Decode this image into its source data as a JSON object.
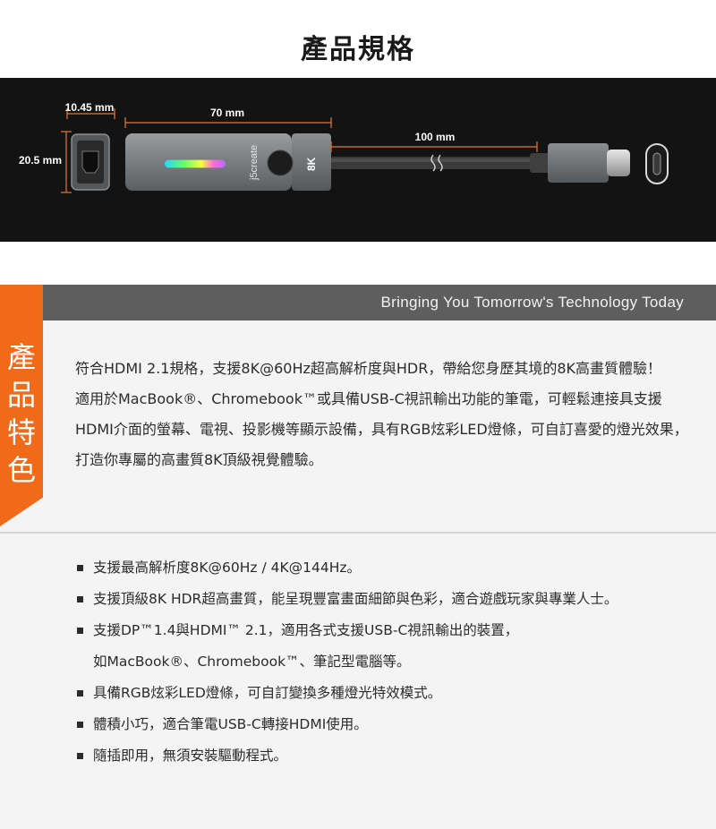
{
  "page": {
    "title": "產品規格"
  },
  "spec_diagram": {
    "dim_port_width": "10.45 mm",
    "dim_port_height": "20.5 mm",
    "dim_body_length": "70 mm",
    "dim_cable_length": "100 mm",
    "brand_logo": "j5create",
    "badge": "8K",
    "colors": {
      "background": "#131313",
      "dimension_line": "#e8782a",
      "body": "#7a7d80"
    }
  },
  "features": {
    "tagline": "Bringing You Tomorrow's Technology Today",
    "tab_label": [
      "產",
      "品",
      "特",
      "色"
    ],
    "intro_paragraph_1": "符合HDMI 2.1規格，支援8K@60Hz超高解析度與HDR，帶給您身歷其境的8K高畫質體驗！",
    "intro_paragraph_2": "適用於MacBook®、Chromebook™或具備USB-C視訊輸出功能的筆電，可輕鬆連接具支援HDMI介面的螢幕、電視、投影機等顯示設備，具有RGB炫彩LED燈條，可自訂喜愛的燈光效果，打造你專屬的高畫質8K頂級視覺體驗。",
    "colors": {
      "accent": "#f06a1a",
      "header_bar": "#5e5e5e",
      "panel": "#f4f4f4"
    }
  },
  "bullets": [
    {
      "text": "支援最高解析度8K@60Hz / 4K@144Hz。"
    },
    {
      "text": "支援頂級8K HDR超高畫質，能呈現豐富畫面細節與色彩，適合遊戲玩家與專業人士。"
    },
    {
      "text": "支援DP™1.4與HDMI™ 2.1，適用各式支援USB-C視訊輸出的裝置，",
      "continuation": "如MacBook®、Chromebook™、筆記型電腦等。"
    },
    {
      "text": "具備RGB炫彩LED燈條，可自訂變換多種燈光特效模式。"
    },
    {
      "text": "體積小巧，適合筆電USB-C轉接HDMI使用。"
    },
    {
      "text": "隨插即用，無須安裝驅動程式。"
    }
  ]
}
